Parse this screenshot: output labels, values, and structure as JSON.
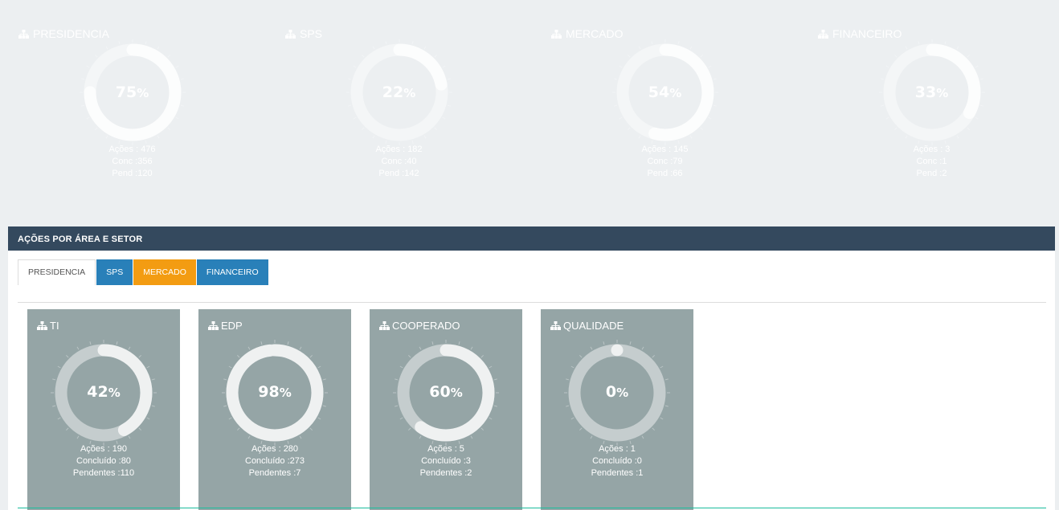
{
  "top_cards": [
    {
      "title": "PRESIDENCIA",
      "color": "#f39c12",
      "percent": 75,
      "pct_label": "75",
      "acoes": "Ações : 476",
      "conc": "Conc :356",
      "pend": "Pend :120"
    },
    {
      "title": "SPS",
      "color": "#2980b9",
      "percent": 22,
      "pct_label": "22",
      "acoes": "Ações : 182",
      "conc": "Conc :40",
      "pend": "Pend :142"
    },
    {
      "title": "MERCADO",
      "color": "#f39c12",
      "percent": 54,
      "pct_label": "54",
      "acoes": "Ações : 145",
      "conc": "Conc :79",
      "pend": "Pend :66"
    },
    {
      "title": "FINANCEIRO",
      "color": "#2980b9",
      "percent": 33,
      "pct_label": "33",
      "acoes": "Ações : 3",
      "conc": "Conc :1",
      "pend": "Pend :2"
    }
  ],
  "panel": {
    "title": "AÇÕES POR ÁREA E SETOR",
    "tabs": [
      {
        "label": "PRESIDENCIA",
        "active": true,
        "color": "#ffffff"
      },
      {
        "label": "SPS",
        "active": false,
        "color": "#2980b9"
      },
      {
        "label": "MERCADO",
        "active": false,
        "color": "#f39c12"
      },
      {
        "label": "FINANCEIRO",
        "active": false,
        "color": "#2980b9"
      }
    ]
  },
  "sub_cards": [
    {
      "title": "TI",
      "percent": 42,
      "pct_label": "42",
      "acoes": "Ações : 190",
      "concluido": "Concluído :80",
      "pendentes": "Pendentes :110"
    },
    {
      "title": "EDP",
      "percent": 98,
      "pct_label": "98",
      "acoes": "Ações : 280",
      "concluido": "Concluído :273",
      "pendentes": "Pendentes :7"
    },
    {
      "title": "COOPERADO",
      "percent": 60,
      "pct_label": "60",
      "acoes": "Ações : 5",
      "concluido": "Concluído :3",
      "pendentes": "Pendentes :2"
    },
    {
      "title": "QUALIDADE",
      "percent": 0,
      "pct_label": "0",
      "acoes": "Ações : 1",
      "concluido": "Concluído :0",
      "pendentes": "Pendentes :1"
    }
  ],
  "icons": {
    "card_title": "sitemap-icon"
  },
  "percent_sign": "%"
}
